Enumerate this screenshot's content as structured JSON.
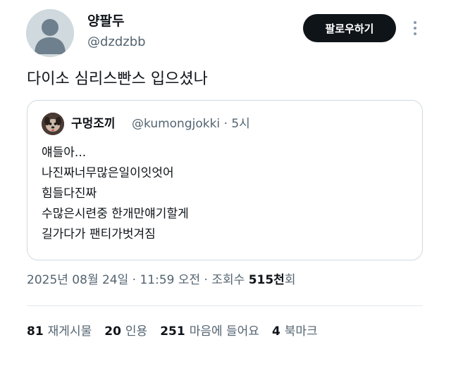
{
  "author": {
    "display_name": "양팔두",
    "handle": "@dzdzbb",
    "avatar_icon": "default-person-icon"
  },
  "follow_button": {
    "label": "팔로우하기"
  },
  "more_icon": "more-vertical-icon",
  "tweet_text": "다이소 심리스빤스 입으셨나",
  "quote": {
    "display_name": "구멍조끼",
    "handle_time": "@kumongjokki · 5시",
    "lines": [
      "얘들아...",
      "나진짜너무많은일이잇엇어",
      "힘들다진짜",
      "수많은시련중 한개만얘기할게",
      "길가다가 팬티가벗겨짐"
    ]
  },
  "meta": {
    "timestamp": "2025년 08월 24일 · 11:59 오전 · 조회수 ",
    "views": "515천",
    "views_suffix": "회"
  },
  "stats": [
    {
      "count": "81",
      "label": "재게시물"
    },
    {
      "count": "20",
      "label": "인용"
    },
    {
      "count": "251",
      "label": "마음에 들어요"
    },
    {
      "count": "4",
      "label": "북마크"
    }
  ],
  "colors": {
    "text": "#0f1419",
    "secondary": "#536471",
    "border": "#cfd9de",
    "button_bg": "#0f1419"
  }
}
